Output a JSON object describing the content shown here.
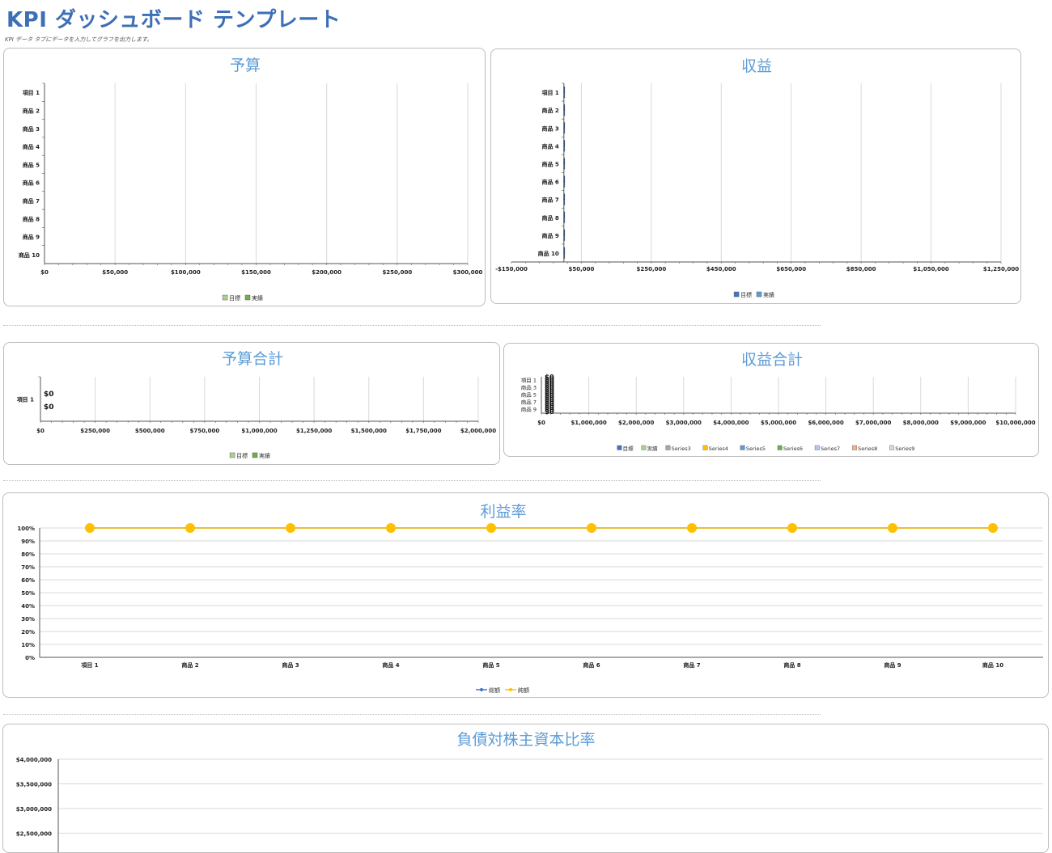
{
  "header": {
    "title": "KPI ダッシュボード テンプレート",
    "subtitle": "KPI データ タブにデータを入力してグラフを出力します。"
  },
  "colors": {
    "title_blue": "#3d6fb6",
    "chart_title": "#5b9bd5",
    "target_green": "#a9d18e",
    "actual_green": "#70ad47",
    "target_blue": "#4472c4",
    "actual_lightblue": "#5b9bd5",
    "gold": "#ffc000",
    "gridline": "#d9d9d9"
  },
  "chart_data": [
    {
      "id": "budget",
      "type": "bar",
      "orientation": "horizontal",
      "title": "予算",
      "categories": [
        "項目 1",
        "商品 2",
        "商品 3",
        "商品 4",
        "商品 5",
        "商品 6",
        "商品 7",
        "商品 8",
        "商品 9",
        "商品 10"
      ],
      "series": [
        {
          "name": "目標",
          "values": [
            0,
            0,
            0,
            0,
            0,
            0,
            0,
            0,
            0,
            0
          ]
        },
        {
          "name": "実績",
          "values": [
            0,
            0,
            0,
            0,
            0,
            0,
            0,
            0,
            0,
            0
          ]
        }
      ],
      "xticks": [
        "$0",
        "$50,000",
        "$100,000",
        "$150,000",
        "$200,000",
        "$250,000",
        "$300,000"
      ],
      "xlim": [
        0,
        300000
      ],
      "grid": true,
      "legend": "bottom"
    },
    {
      "id": "revenue",
      "type": "bar",
      "orientation": "horizontal",
      "title": "収益",
      "categories": [
        "項目 1",
        "商品 2",
        "商品 3",
        "商品 4",
        "商品 5",
        "商品 6",
        "商品 7",
        "商品 8",
        "商品 9",
        "商品 10"
      ],
      "series": [
        {
          "name": "目標",
          "values": [
            0,
            0,
            0,
            0,
            0,
            0,
            0,
            0,
            0,
            0
          ]
        },
        {
          "name": "実績",
          "values": [
            0,
            0,
            0,
            0,
            0,
            0,
            0,
            0,
            0,
            0
          ]
        }
      ],
      "xticks": [
        "-$150,000",
        "$50,000",
        "$250,000",
        "$450,000",
        "$650,000",
        "$850,000",
        "$1,050,000",
        "$1,250,000"
      ],
      "xlim": [
        -150000,
        1250000
      ],
      "grid": true,
      "legend": "bottom"
    },
    {
      "id": "budget-total",
      "type": "bar",
      "orientation": "horizontal",
      "title": "予算合計",
      "categories": [
        "項目 1"
      ],
      "series": [
        {
          "name": "目標",
          "values": [
            0
          ]
        },
        {
          "name": "実績",
          "values": [
            0
          ]
        }
      ],
      "data_labels": [
        "$0",
        "$0"
      ],
      "xticks": [
        "$0",
        "$250,000",
        "$500,000",
        "$750,000",
        "$1,000,000",
        "$1,250,000",
        "$1,500,000",
        "$1,750,000",
        "$2,000,000"
      ],
      "xlim": [
        0,
        2000000
      ],
      "grid": true,
      "legend": "bottom"
    },
    {
      "id": "revenue-total",
      "type": "bar",
      "orientation": "horizontal",
      "title": "収益合計",
      "categories": [
        "項目 1",
        "商品 3",
        "商品 5",
        "商品 7",
        "商品 9"
      ],
      "series": [
        {
          "name": "目標",
          "values": [
            0,
            0,
            0,
            0,
            0
          ]
        },
        {
          "name": "実績",
          "values": [
            0,
            0,
            0,
            0,
            0
          ]
        },
        {
          "name": "Series3",
          "values": []
        },
        {
          "name": "Series4",
          "values": []
        },
        {
          "name": "Series5",
          "values": []
        },
        {
          "name": "Series6",
          "values": []
        },
        {
          "name": "Series7",
          "values": []
        },
        {
          "name": "Series8",
          "values": []
        },
        {
          "name": "Series9",
          "values": []
        }
      ],
      "data_labels": [
        "$0",
        "$0",
        "$0",
        "$0",
        "$0",
        "$0",
        "$0",
        "$0",
        "$0",
        "$0",
        "$0",
        "$0",
        "$0",
        "$0",
        "$0",
        "$0",
        "$0",
        "$0"
      ],
      "legend_colors": [
        "#4472c4",
        "#a9d18e",
        "#a5a5a5",
        "#ffc000",
        "#5b9bd5",
        "#70ad47",
        "#b4c7e7",
        "#f4b183",
        "#d9d9d9"
      ],
      "xticks": [
        "$0",
        "$1,000,000",
        "$2,000,000",
        "$3,000,000",
        "$4,000,000",
        "$5,000,000",
        "$6,000,000",
        "$7,000,000",
        "$8,000,000",
        "$9,000,000",
        "$10,000,000"
      ],
      "xlim": [
        0,
        10000000
      ],
      "grid": true,
      "legend": "bottom"
    },
    {
      "id": "profit-rate",
      "type": "line",
      "title": "利益率",
      "categories": [
        "項目 1",
        "商品 2",
        "商品 3",
        "商品 4",
        "商品 5",
        "商品 6",
        "商品 7",
        "商品 8",
        "商品 9",
        "商品 10"
      ],
      "series": [
        {
          "name": "総額",
          "values": [
            1,
            1,
            1,
            1,
            1,
            1,
            1,
            1,
            1,
            1
          ]
        },
        {
          "name": "純額",
          "values": [
            1,
            1,
            1,
            1,
            1,
            1,
            1,
            1,
            1,
            1
          ]
        }
      ],
      "yticks": [
        "0%",
        "10%",
        "20%",
        "30%",
        "40%",
        "50%",
        "60%",
        "70%",
        "80%",
        "90%",
        "100%"
      ],
      "ylim": [
        0,
        1
      ],
      "grid": true,
      "legend": "bottom"
    },
    {
      "id": "debt-equity",
      "type": "bar",
      "title": "負債対株主資本比率",
      "yticks": [
        "$2,500,000",
        "$3,000,000",
        "$3,500,000",
        "$4,000,000"
      ],
      "ylim": [
        2500000,
        4000000
      ],
      "grid": true
    }
  ]
}
